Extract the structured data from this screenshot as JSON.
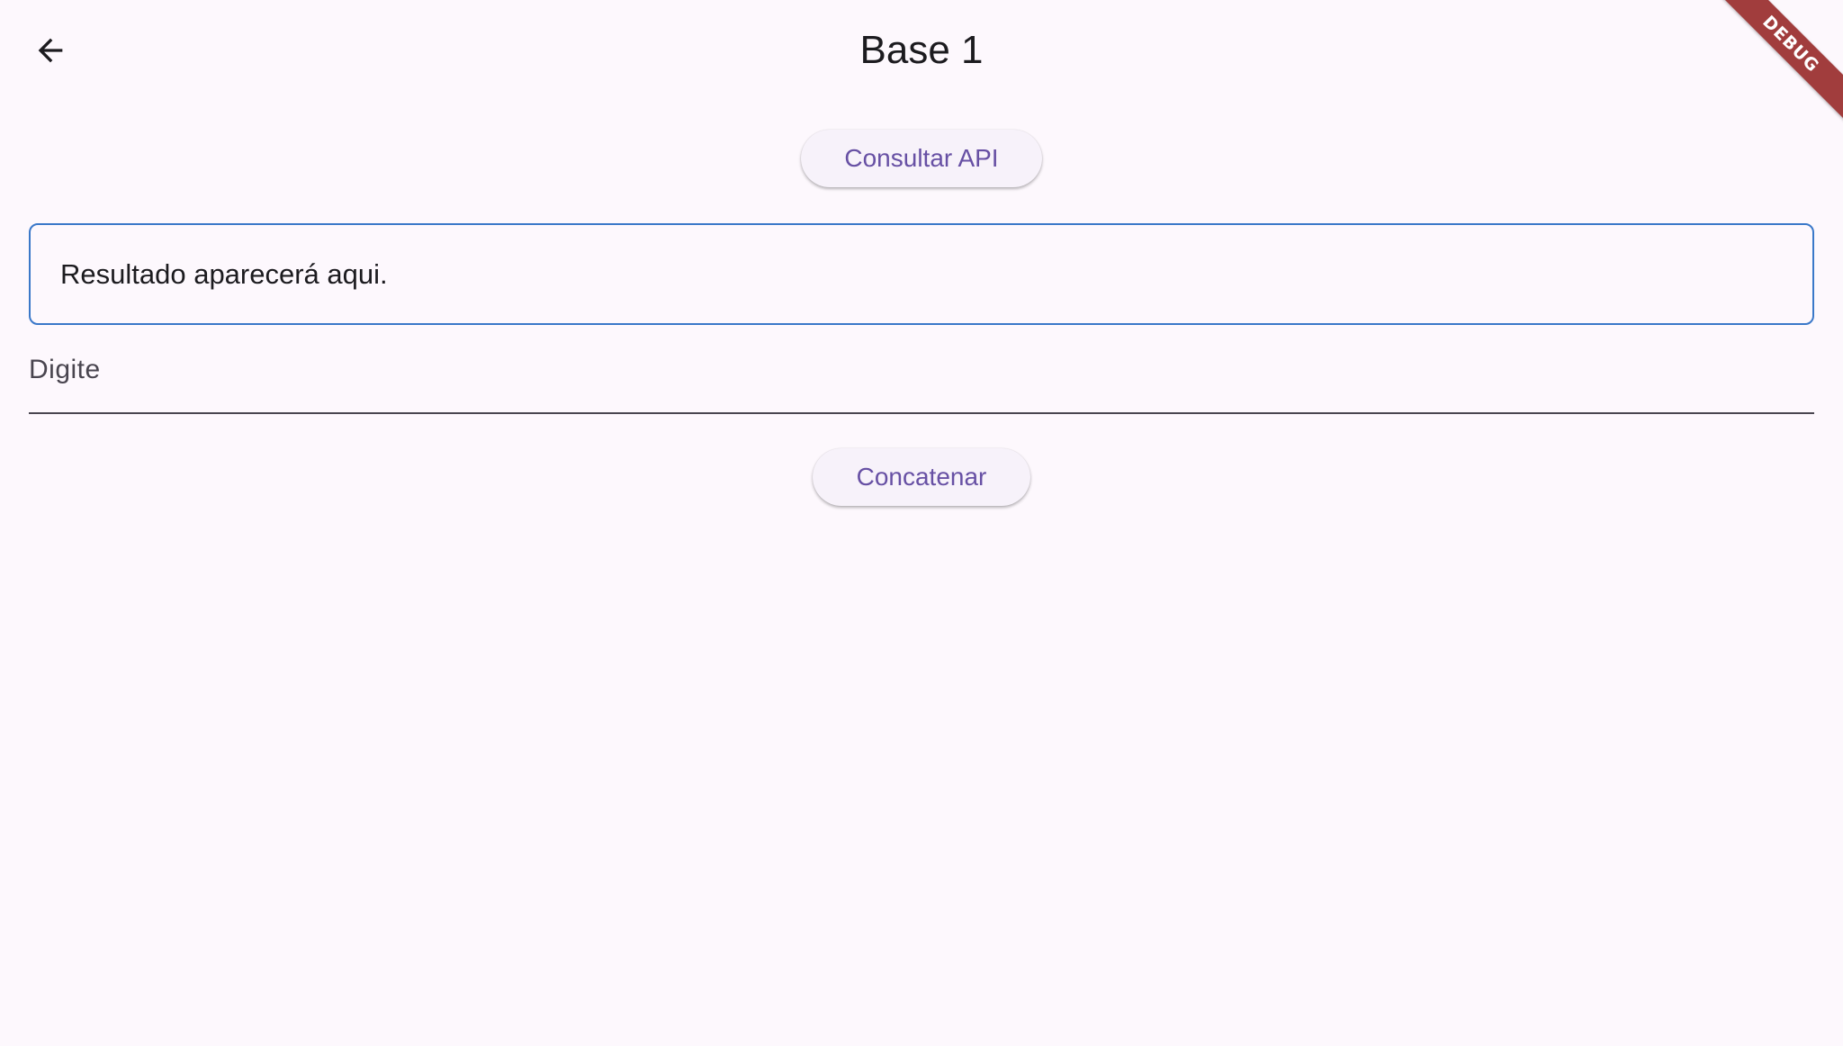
{
  "app_bar": {
    "back_icon": "arrow-left-icon",
    "title": "Base 1"
  },
  "actions": {
    "consult_api_label": "Consultar API",
    "concatenate_label": "Concatenar"
  },
  "result": {
    "text": "Resultado aparecerá aqui."
  },
  "input": {
    "label": "Digite",
    "value": ""
  },
  "debug_banner": {
    "text": "DEBUG"
  },
  "colors": {
    "background": "#fdf8fd",
    "primary": "#6750a4",
    "result_border": "#3a78c9",
    "debug_banner": "#a13d3d"
  }
}
